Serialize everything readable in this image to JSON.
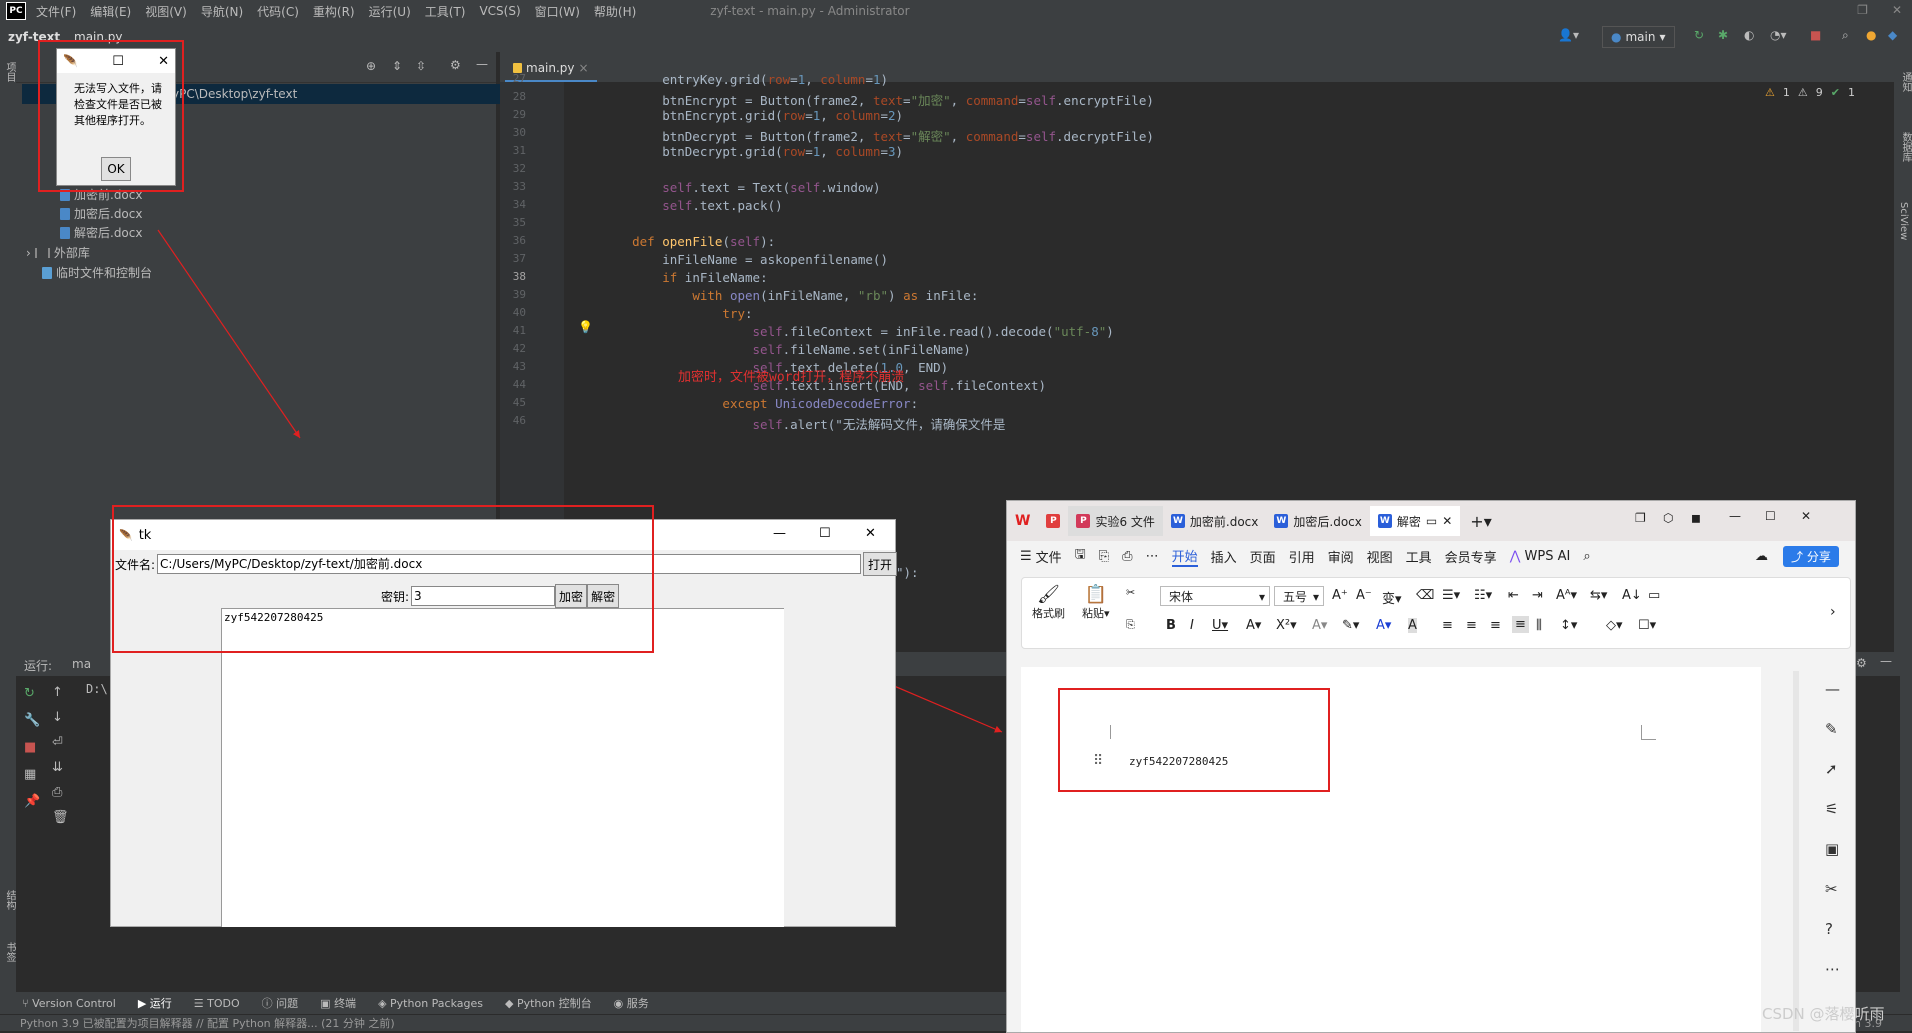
{
  "ide": {
    "menu": [
      "文件(F)",
      "编辑(E)",
      "视图(V)",
      "导航(N)",
      "代码(C)",
      "重构(R)",
      "运行(U)",
      "工具(T)",
      "VCS(S)",
      "窗口(W)",
      "帮助(H)"
    ],
    "logo": "PC",
    "window_title": "zyf-text - main.py - Administrator",
    "crumbs": {
      "project": "zyf-text",
      "file": "main.py"
    },
    "branch": "main",
    "project_path": "C:\\Users\\MyPC\\Desktop\\zyf-text",
    "project_path_visible": "yPC\\Desktop\\zyf-text",
    "tree": [
      "加密前.docx",
      "加密后.docx",
      "解密后.docx",
      "外部库",
      "临时文件和控制台"
    ],
    "editor_tab": "main.py",
    "inspections": {
      "warn": "1",
      "weak": "9",
      "ok": "1"
    },
    "run_label": "运行:",
    "run_tab": "ma",
    "console_line": "D:\\",
    "bottom_tabs": [
      "Version Control",
      "运行",
      "TODO",
      "问题",
      "终端",
      "Python Packages",
      "Python 控制台",
      "服务"
    ],
    "status": "Python 3.9 已被配置为项目解释器 // 配置 Python 解释器... (21 分钟 之前)",
    "status_right": "n 3.9",
    "left_strip": [
      "项目",
      "结构",
      "书签"
    ],
    "right_strip": [
      "通知",
      "数据库",
      "SciView"
    ],
    "annotation": "加密时，文件被word打开，程序不崩溃"
  },
  "code": [
    {
      "n": "27",
      "t": "        entryKey.grid(row=1, column=1)"
    },
    {
      "n": "28",
      "t": "        btnEncrypt = Button(frame2, text=\"加密\", command=self.encryptFile)"
    },
    {
      "n": "29",
      "t": "        btnEncrypt.grid(row=1, column=2)"
    },
    {
      "n": "30",
      "t": "        btnDecrypt = Button(frame2, text=\"解密\", command=self.decryptFile)"
    },
    {
      "n": "31",
      "t": "        btnDecrypt.grid(row=1, column=3)"
    },
    {
      "n": "32",
      "t": ""
    },
    {
      "n": "33",
      "t": "        self.text = Text(self.window)"
    },
    {
      "n": "34",
      "t": "        self.text.pack()"
    },
    {
      "n": "35",
      "t": ""
    },
    {
      "n": "36",
      "t": "    def openFile(self):"
    },
    {
      "n": "37",
      "t": "        inFileName = askopenfilename()"
    },
    {
      "n": "38",
      "t": "        if inFileName:"
    },
    {
      "n": "39",
      "t": "            with open(inFileName, \"rb\") as inFile:"
    },
    {
      "n": "40",
      "t": "                try:"
    },
    {
      "n": "41",
      "t": "                    self.fileContext = inFile.read().decode(\"utf-8\")"
    },
    {
      "n": "42",
      "t": "                    self.fileName.set(inFileName)"
    },
    {
      "n": "43",
      "t": "                    self.text.delete(1.0, END)"
    },
    {
      "n": "44",
      "t": "                    self.text.insert(END, self.fileContext)"
    },
    {
      "n": "45",
      "t": "                except UnicodeDecodeError:"
    },
    {
      "n": "46",
      "t": "                    self.alert(\"无法解码文件，请确保文件是"
    }
  ],
  "code_tail": "\"):",
  "alert": {
    "message": "无法写入文件，请检查文件是否已被其他程序打开。",
    "ok": "OK"
  },
  "tk": {
    "title": "tk",
    "file_label": "文件名:",
    "file_path": "C:/Users/MyPC/Desktop/zyf-text/加密前.docx",
    "open": "打开",
    "key_label": "密钥:",
    "key_value": "3",
    "encrypt": "加密",
    "decrypt": "解密",
    "text": "zyf542207280425"
  },
  "wps": {
    "tabs": [
      "实验6 文件",
      "加密前.docx",
      "加密后.docx",
      "解密"
    ],
    "menu": [
      "文件",
      "开始",
      "插入",
      "页面",
      "引用",
      "审阅",
      "视图",
      "工具",
      "会员专享"
    ],
    "wps_ai": "WPS AI",
    "share": "分享",
    "font": "宋体",
    "size": "五号",
    "format_painter": "格式刷",
    "paste": "粘贴",
    "doc_text": "zyf542207280425"
  },
  "watermark": "CSDN @落樱听雨"
}
